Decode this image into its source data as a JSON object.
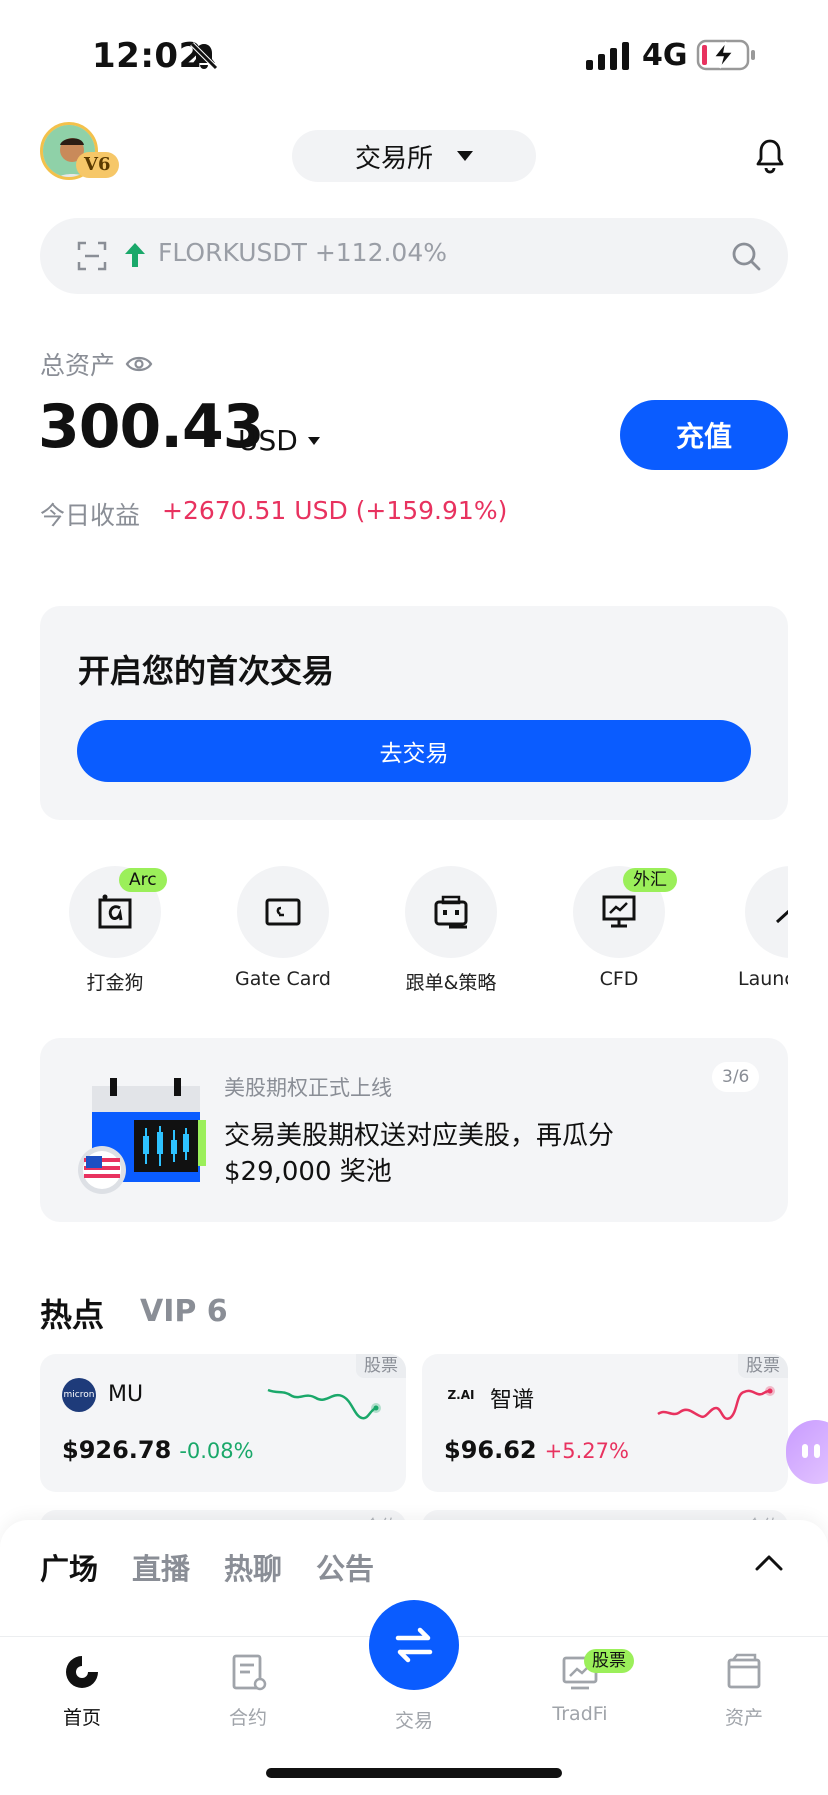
{
  "status_bar": {
    "time": "12:02",
    "network": "4G"
  },
  "header": {
    "vip_level": "V6",
    "exchange_label": "交易所"
  },
  "search": {
    "text": "FLORKUSDT +112.04%"
  },
  "assets": {
    "label": "总资产",
    "value": "300.43",
    "currency": "USD",
    "deposit_label": "充值",
    "today_label": "今日收益",
    "today_value": "+2670.51 USD (+159.91%)"
  },
  "first_trade": {
    "title": "开启您的首次交易",
    "button_label": "去交易"
  },
  "quick_entries": [
    {
      "label": "打金狗",
      "tag": "Arc",
      "icon": "alpha-icon"
    },
    {
      "label": "Gate Card",
      "tag": "",
      "icon": "card-icon"
    },
    {
      "label": "跟单&策略",
      "tag": "",
      "icon": "bot-icon"
    },
    {
      "label": "CFD",
      "tag": "外汇",
      "icon": "chart-board-icon"
    },
    {
      "label": "Launc",
      "tag": "",
      "icon": "launch-icon"
    }
  ],
  "banner": {
    "subtitle": "美股期权正式上线",
    "title": "交易美股期权送对应美股，再瓜分 $29,000 奖池",
    "page_indicator": "3/6"
  },
  "hot": {
    "title": "热点",
    "vip_tab": "VIP 6",
    "cards": [
      {
        "tag": "股票",
        "logo_text": "micron",
        "name": "MU",
        "price": "$926.78",
        "change": "-0.08%",
        "change_color": "#1aa86a"
      },
      {
        "tag": "股票",
        "logo_text": "Z.AI",
        "name": "智谱",
        "price": "$96.62",
        "change": "+5.27%",
        "change_color": "#e8325f"
      }
    ],
    "peek_tags": [
      "合约",
      "合约"
    ]
  },
  "social_tabs": [
    "广场",
    "直播",
    "热聊",
    "公告"
  ],
  "bottom_nav": {
    "home": "首页",
    "futures": "合约",
    "trade": "交易",
    "tradfi": "TradFi",
    "tradfi_tag": "股票",
    "assets": "资产"
  },
  "colors": {
    "brand_blue": "#0a5cff",
    "gain_red": "#e8325f",
    "loss_green": "#1aa86a",
    "tag_green": "#9bef5a"
  }
}
